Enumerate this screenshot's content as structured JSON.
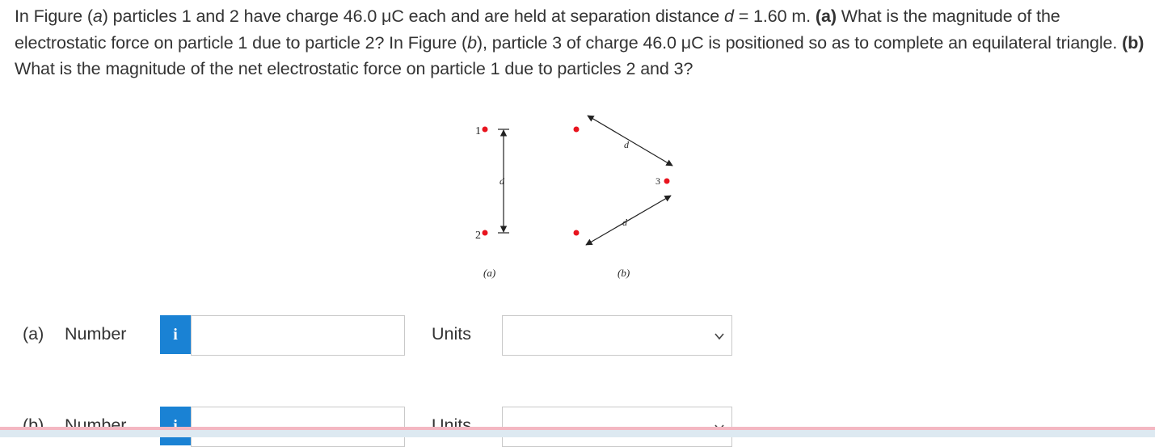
{
  "question": {
    "s1": "In Figure (",
    "s2": "a",
    "s3": ") particles 1 and 2 have charge 46.0 μC each and are held at separation distance ",
    "s4": "d",
    "s5": " = 1.60 m. ",
    "s6": "(a)",
    "s7": " What is the magnitude of the electrostatic force on particle 1 due to particle 2? In Figure (",
    "s8": "b",
    "s9": "), particle 3 of charge 46.0 μC is positioned so as to complete an equilateral triangle. ",
    "s10": "(b)",
    "s11": " What is the magnitude of the net electrostatic force on particle 1 due to particles 2 and 3?"
  },
  "figure": {
    "p1_label": "1",
    "p2_label": "2",
    "p3_label": "3",
    "d_label": "d",
    "caption_a": "(a)",
    "caption_b": "(b)",
    "charge_color": "#e8141e"
  },
  "answers": [
    {
      "part": "(a)",
      "number_label": "Number",
      "info_icon": "i",
      "value": "",
      "units_label": "Units",
      "units_value": ""
    },
    {
      "part": "(b)",
      "number_label": "Number",
      "info_icon": "i",
      "value": "",
      "units_label": "Units",
      "units_value": ""
    }
  ],
  "colors": {
    "info_button": "#1a82d4",
    "bottom_bar_pink": "#f4b7c2",
    "bottom_bar_blue": "#dde9f1"
  }
}
